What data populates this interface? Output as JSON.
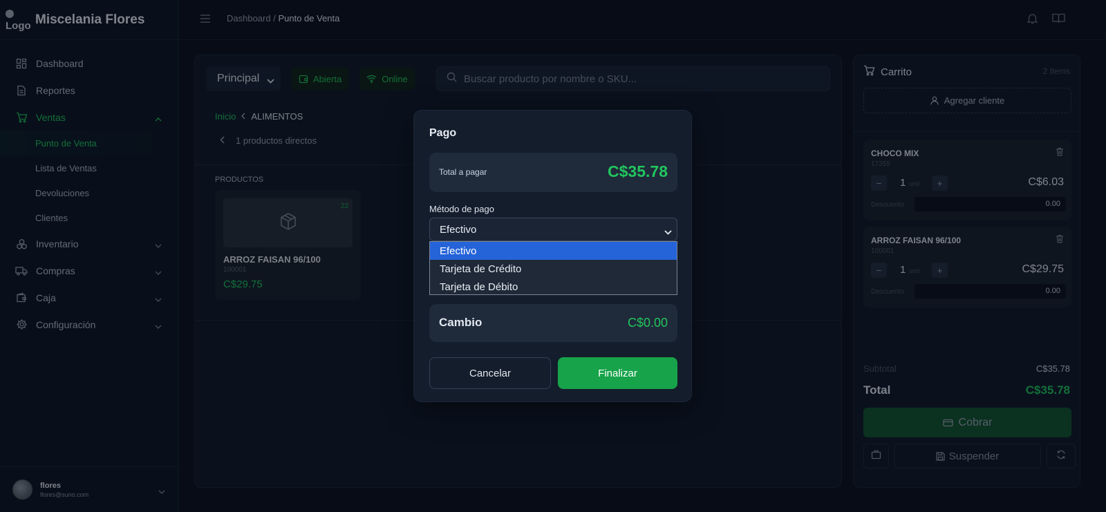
{
  "app": {
    "logo_text": "Logo",
    "name": "Miscelania Flores"
  },
  "sidebar": {
    "items": [
      {
        "label": "Dashboard",
        "icon": "grid-icon"
      },
      {
        "label": "Reportes",
        "icon": "document-icon"
      },
      {
        "label": "Ventas",
        "icon": "cart-icon",
        "expanded": true
      },
      {
        "label": "Inventario",
        "icon": "boxes-icon"
      },
      {
        "label": "Compras",
        "icon": "truck-icon"
      },
      {
        "label": "Caja",
        "icon": "wallet-icon"
      },
      {
        "label": "Configuración",
        "icon": "gear-icon"
      }
    ],
    "ventas_sub": [
      {
        "label": "Punto de Venta",
        "active": true
      },
      {
        "label": "Lista de Ventas"
      },
      {
        "label": "Devoluciones"
      },
      {
        "label": "Clientes"
      }
    ],
    "user": {
      "name": "flores",
      "email": "flores@suno.com"
    }
  },
  "header": {
    "breadcrumb_parent": "Dashboard",
    "breadcrumb_sep": " / ",
    "breadcrumb_current": "Punto de Venta"
  },
  "pos": {
    "warehouse": "Principal",
    "status_register": "Abierta",
    "status_connection": "Online",
    "search_placeholder": "Buscar producto por nombre o SKU...",
    "crumb_root": "Inicio",
    "crumb_current": "ALIMENTOS",
    "direct_products": "1 productos directos",
    "products_label": "PRODUCTOS",
    "products": [
      {
        "name": "ARROZ FAISAN 96/100",
        "sku": "100001",
        "price": "C$29.75",
        "stock": "23"
      }
    ]
  },
  "cart": {
    "title": "Carrito",
    "count": "2 Items",
    "add_client": "Agregar cliente",
    "items": [
      {
        "name": "CHOCO MIX",
        "sku": "17355",
        "qty": "1",
        "unit": "und",
        "price": "C$6.03",
        "discount_label": "Descuento",
        "discount": "0.00"
      },
      {
        "name": "ARROZ FAISAN 96/100",
        "sku": "100001",
        "qty": "1",
        "unit": "und",
        "price": "C$29.75",
        "discount_label": "Descuento",
        "discount": "0.00"
      }
    ],
    "subtotal_label": "Subtotal",
    "subtotal": "C$35.78",
    "total_label": "Total",
    "total": "C$35.78",
    "charge_label": "Cobrar",
    "suspend_label": "Suspender"
  },
  "payment_modal": {
    "title": "Pago",
    "total_label": "Total a pagar",
    "total": "C$35.78",
    "method_label": "Método de pago",
    "method_selected": "Efectivo",
    "options": [
      "Efectivo",
      "Tarjeta de Crédito",
      "Tarjeta de Débito"
    ],
    "change_label": "Cambio",
    "change": "C$0.00",
    "cancel_label": "Cancelar",
    "finish_label": "Finalizar"
  },
  "colors": {
    "accent": "#22c55e",
    "background": "#0b1220",
    "panel": "#111a2a",
    "selected_option": "#2563d9"
  }
}
